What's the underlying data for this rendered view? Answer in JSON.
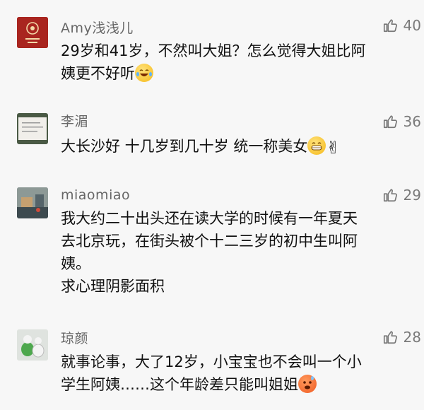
{
  "comments": [
    {
      "user": "Amy浅浅儿",
      "likes": "40",
      "lines": [
        "29岁和41岁，不然叫大姐？怎么觉得大姐比阿",
        "姨更不好听"
      ],
      "emoji": "laughing-crying-emoji",
      "avatar": "red-seal-avatar"
    },
    {
      "user": "李湄",
      "likes": "36",
      "lines": [
        "大长沙好 十几岁到几十岁 统一称美女"
      ],
      "emoji": "grin-emoji victory-hand-emoji",
      "avatar": "paper-note-avatar"
    },
    {
      "user": "miaomiao",
      "likes": "29",
      "lines": [
        "我大约二十出头还在读大学的时候有一年夏天",
        "去北京玩，在街头被个十二三岁的初中生叫阿",
        "姨。",
        "求心理阴影面积"
      ],
      "avatar": "street-scene-avatar"
    },
    {
      "user": "琼颜",
      "likes": "28",
      "lines": [
        "就事论事，大了12岁，小宝宝也不会叫一个小",
        "学生阿姨……这个年龄差只能叫姐姐"
      ],
      "emoji": "hot-face-emoji",
      "avatar": "green-figure-avatar"
    }
  ],
  "icons": {
    "like": "thumbs-up-icon"
  },
  "colors": {
    "background": "#f7f7f7",
    "username": "#666666",
    "text": "#111111",
    "likes": "#7a7a7a"
  }
}
